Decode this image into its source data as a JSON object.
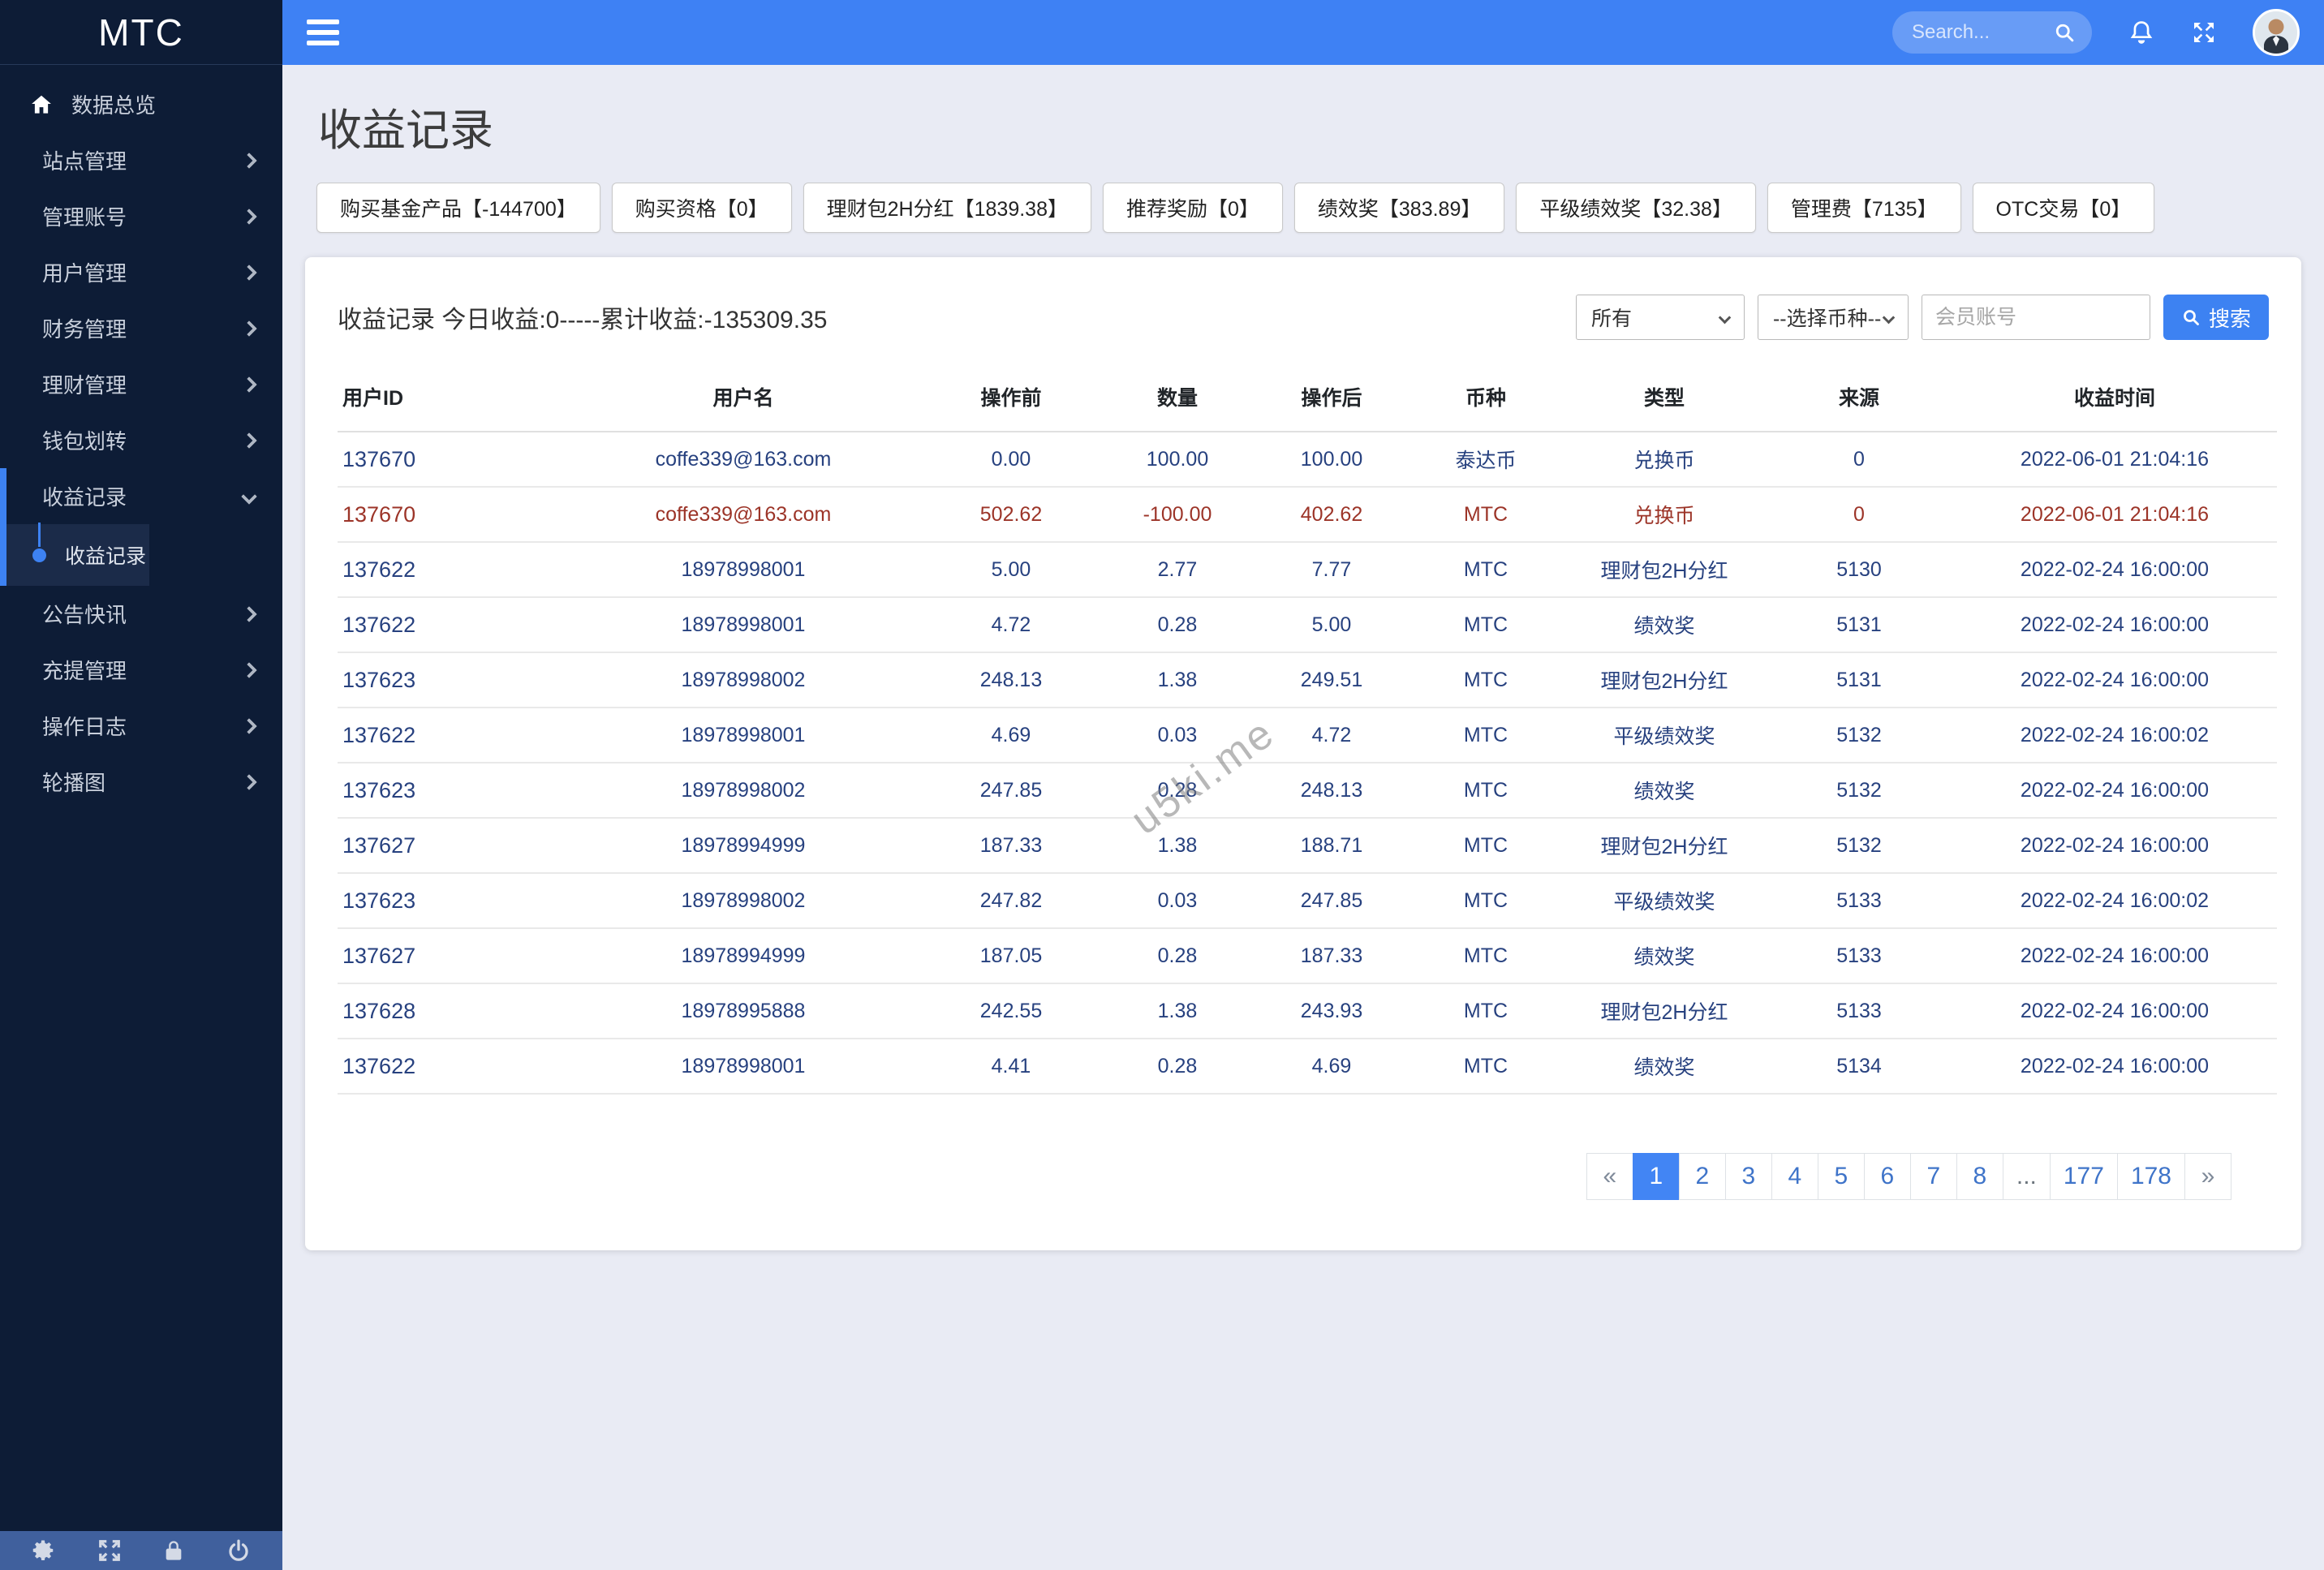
{
  "brand": "MTC",
  "topbar": {
    "search_placeholder": "Search...",
    "icons": [
      "bell-icon",
      "expand-icon",
      "user-avatar"
    ]
  },
  "sidebar": {
    "items": [
      {
        "label": "数据总览",
        "type": "link",
        "icon": "home-icon"
      },
      {
        "label": "站点管理",
        "type": "group"
      },
      {
        "label": "管理账号",
        "type": "group"
      },
      {
        "label": "用户管理",
        "type": "group"
      },
      {
        "label": "财务管理",
        "type": "group"
      },
      {
        "label": "理财管理",
        "type": "group"
      },
      {
        "label": "钱包划转",
        "type": "group"
      },
      {
        "label": "收益记录",
        "type": "group",
        "expanded": true,
        "children": [
          {
            "label": "收益记录",
            "active": true
          }
        ]
      },
      {
        "label": "公告快讯",
        "type": "group"
      },
      {
        "label": "充提管理",
        "type": "group"
      },
      {
        "label": "操作日志",
        "type": "group"
      },
      {
        "label": "轮播图",
        "type": "group"
      }
    ],
    "footer_icons": [
      "gear-icon",
      "expand-icon",
      "lock-icon",
      "power-icon"
    ]
  },
  "page": {
    "title": "收益记录"
  },
  "stats": [
    "购买基金产品【-144700】",
    "购买资格【0】",
    "理财包2H分红【1839.38】",
    "推荐奖励【0】",
    "绩效奖【383.89】",
    "平级绩效奖【32.38】",
    "管理费【7135】",
    "OTC交易【0】"
  ],
  "panel": {
    "summary": "收益记录 今日收益:0-----累计收益:-135309.35",
    "filters": {
      "type_select": "所有",
      "coin_select": "--选择币种--",
      "account_placeholder": "会员账号",
      "search_button": "搜索"
    }
  },
  "table": {
    "headers": [
      "用户ID",
      "用户名",
      "操作前",
      "数量",
      "操作后",
      "币种",
      "类型",
      "来源",
      "收益时间"
    ],
    "rows": [
      {
        "tone": "blue",
        "cells": [
          "137670",
          "coffe339@163.com",
          "0.00",
          "100.00",
          "100.00",
          "泰达币",
          "兑换币",
          "0",
          "2022-06-01 21:04:16"
        ]
      },
      {
        "tone": "red",
        "cells": [
          "137670",
          "coffe339@163.com",
          "502.62",
          "-100.00",
          "402.62",
          "MTC",
          "兑换币",
          "0",
          "2022-06-01 21:04:16"
        ]
      },
      {
        "tone": "blue",
        "cells": [
          "137622",
          "18978998001",
          "5.00",
          "2.77",
          "7.77",
          "MTC",
          "理财包2H分红",
          "5130",
          "2022-02-24 16:00:00"
        ]
      },
      {
        "tone": "blue",
        "cells": [
          "137622",
          "18978998001",
          "4.72",
          "0.28",
          "5.00",
          "MTC",
          "绩效奖",
          "5131",
          "2022-02-24 16:00:00"
        ]
      },
      {
        "tone": "blue",
        "cells": [
          "137623",
          "18978998002",
          "248.13",
          "1.38",
          "249.51",
          "MTC",
          "理财包2H分红",
          "5131",
          "2022-02-24 16:00:00"
        ]
      },
      {
        "tone": "blue",
        "cells": [
          "137622",
          "18978998001",
          "4.69",
          "0.03",
          "4.72",
          "MTC",
          "平级绩效奖",
          "5132",
          "2022-02-24 16:00:02"
        ]
      },
      {
        "tone": "blue",
        "cells": [
          "137623",
          "18978998002",
          "247.85",
          "0.28",
          "248.13",
          "MTC",
          "绩效奖",
          "5132",
          "2022-02-24 16:00:00"
        ]
      },
      {
        "tone": "blue",
        "cells": [
          "137627",
          "18978994999",
          "187.33",
          "1.38",
          "188.71",
          "MTC",
          "理财包2H分红",
          "5132",
          "2022-02-24 16:00:00"
        ]
      },
      {
        "tone": "blue",
        "cells": [
          "137623",
          "18978998002",
          "247.82",
          "0.03",
          "247.85",
          "MTC",
          "平级绩效奖",
          "5133",
          "2022-02-24 16:00:02"
        ]
      },
      {
        "tone": "blue",
        "cells": [
          "137627",
          "18978994999",
          "187.05",
          "0.28",
          "187.33",
          "MTC",
          "绩效奖",
          "5133",
          "2022-02-24 16:00:00"
        ]
      },
      {
        "tone": "blue",
        "cells": [
          "137628",
          "18978995888",
          "242.55",
          "1.38",
          "243.93",
          "MTC",
          "理财包2H分红",
          "5133",
          "2022-02-24 16:00:00"
        ]
      },
      {
        "tone": "blue",
        "cells": [
          "137622",
          "18978998001",
          "4.41",
          "0.28",
          "4.69",
          "MTC",
          "绩效奖",
          "5134",
          "2022-02-24 16:00:00"
        ]
      }
    ]
  },
  "pagination": {
    "items": [
      "«",
      "1",
      "2",
      "3",
      "4",
      "5",
      "6",
      "7",
      "8",
      "...",
      "177",
      "178",
      "»"
    ],
    "active": "1"
  },
  "watermark": "u5ki.me",
  "colors": {
    "accent": "#3e81f4",
    "sidebar_bg": "#0d1c36",
    "row_blue": "#27417f",
    "row_red": "#9c3428",
    "active_page": "#4285f4",
    "footer_bar": "#40609d"
  }
}
